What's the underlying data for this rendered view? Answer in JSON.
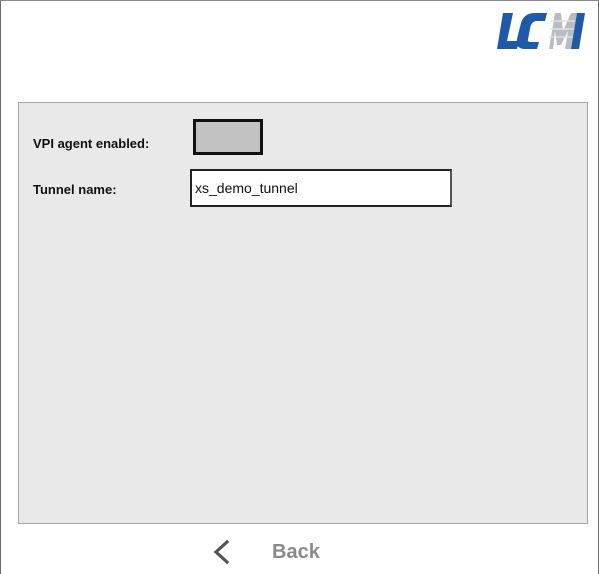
{
  "header": {
    "logo_text": "LCM",
    "brand_color": "#1e5aa8"
  },
  "form": {
    "vpi_agent_label": "VPI agent enabled:",
    "vpi_agent_enabled": false,
    "tunnel_name_label": "Tunnel name:",
    "tunnel_name_value": "xs_demo_tunnel"
  },
  "footer": {
    "back_label": "Back",
    "back_icon": "chevron-left-icon"
  }
}
